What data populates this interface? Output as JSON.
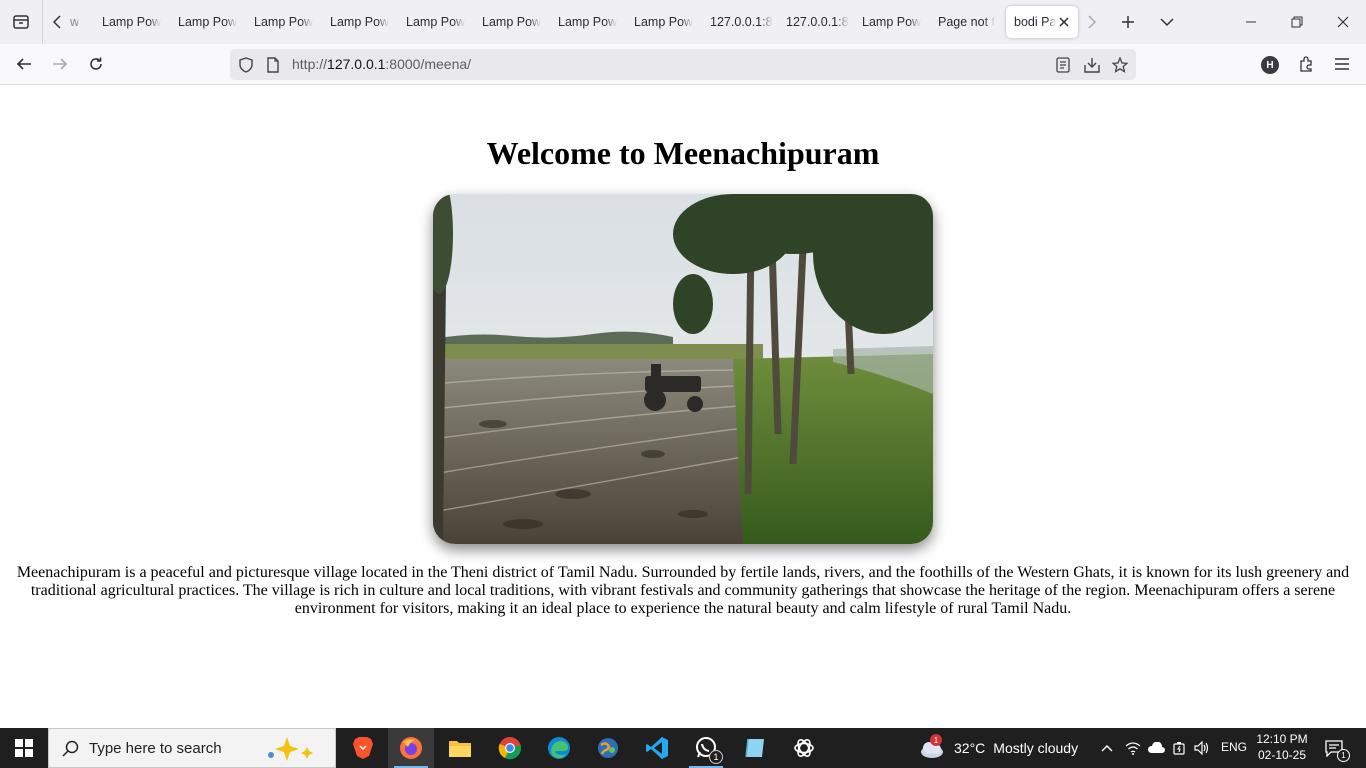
{
  "browser": {
    "tabs": [
      {
        "label": "Lamp Pow"
      },
      {
        "label": "Lamp Pow"
      },
      {
        "label": "Lamp Pow"
      },
      {
        "label": "Lamp Pow"
      },
      {
        "label": "Lamp Pow"
      },
      {
        "label": "Lamp Pow"
      },
      {
        "label": "Lamp Pow"
      },
      {
        "label": "Lamp Pow"
      },
      {
        "label": "127.0.0.1:8"
      },
      {
        "label": "127.0.0.1:8"
      },
      {
        "label": "Lamp Pow"
      },
      {
        "label": "Page not f"
      },
      {
        "label": "bodi Pa",
        "active": true
      }
    ],
    "partial_tab_label": "w",
    "url_prefix": "http://",
    "url_host": "127.0.0.1",
    "url_path": ":8000/meena/",
    "profile_initial": "H"
  },
  "page": {
    "title": "Welcome to Meenachipuram",
    "description": "Meenachipuram is a peaceful and picturesque village located in the Theni district of Tamil Nadu. Surrounded by fertile lands, rivers, and the foothills of the Western Ghats, it is known for its lush greenery and traditional agricultural practices. The village is rich in culture and local traditions, with vibrant festivals and community gatherings that showcase the heritage of the region. Meenachipuram offers a serene environment for visitors, making it an ideal place to experience the natural beauty and calm lifestyle of rural Tamil Nadu."
  },
  "taskbar": {
    "search_placeholder": "Type here to search",
    "apps": [
      {
        "name": "brave-icon"
      },
      {
        "name": "firefox-icon",
        "active": true
      },
      {
        "name": "file-explorer-icon"
      },
      {
        "name": "chrome-icon"
      },
      {
        "name": "edge-icon"
      },
      {
        "name": "globe-app-icon"
      },
      {
        "name": "vscode-icon"
      },
      {
        "name": "whatsapp-icon",
        "badge": "1"
      },
      {
        "name": "notes-app-icon"
      },
      {
        "name": "chatgpt-icon"
      }
    ],
    "weather_badge": "1",
    "weather_temp": "32°C",
    "weather_desc": "Mostly cloudy",
    "language": "ENG",
    "time": "12:10 PM",
    "date": "02-10-25",
    "notification_count": "1"
  }
}
